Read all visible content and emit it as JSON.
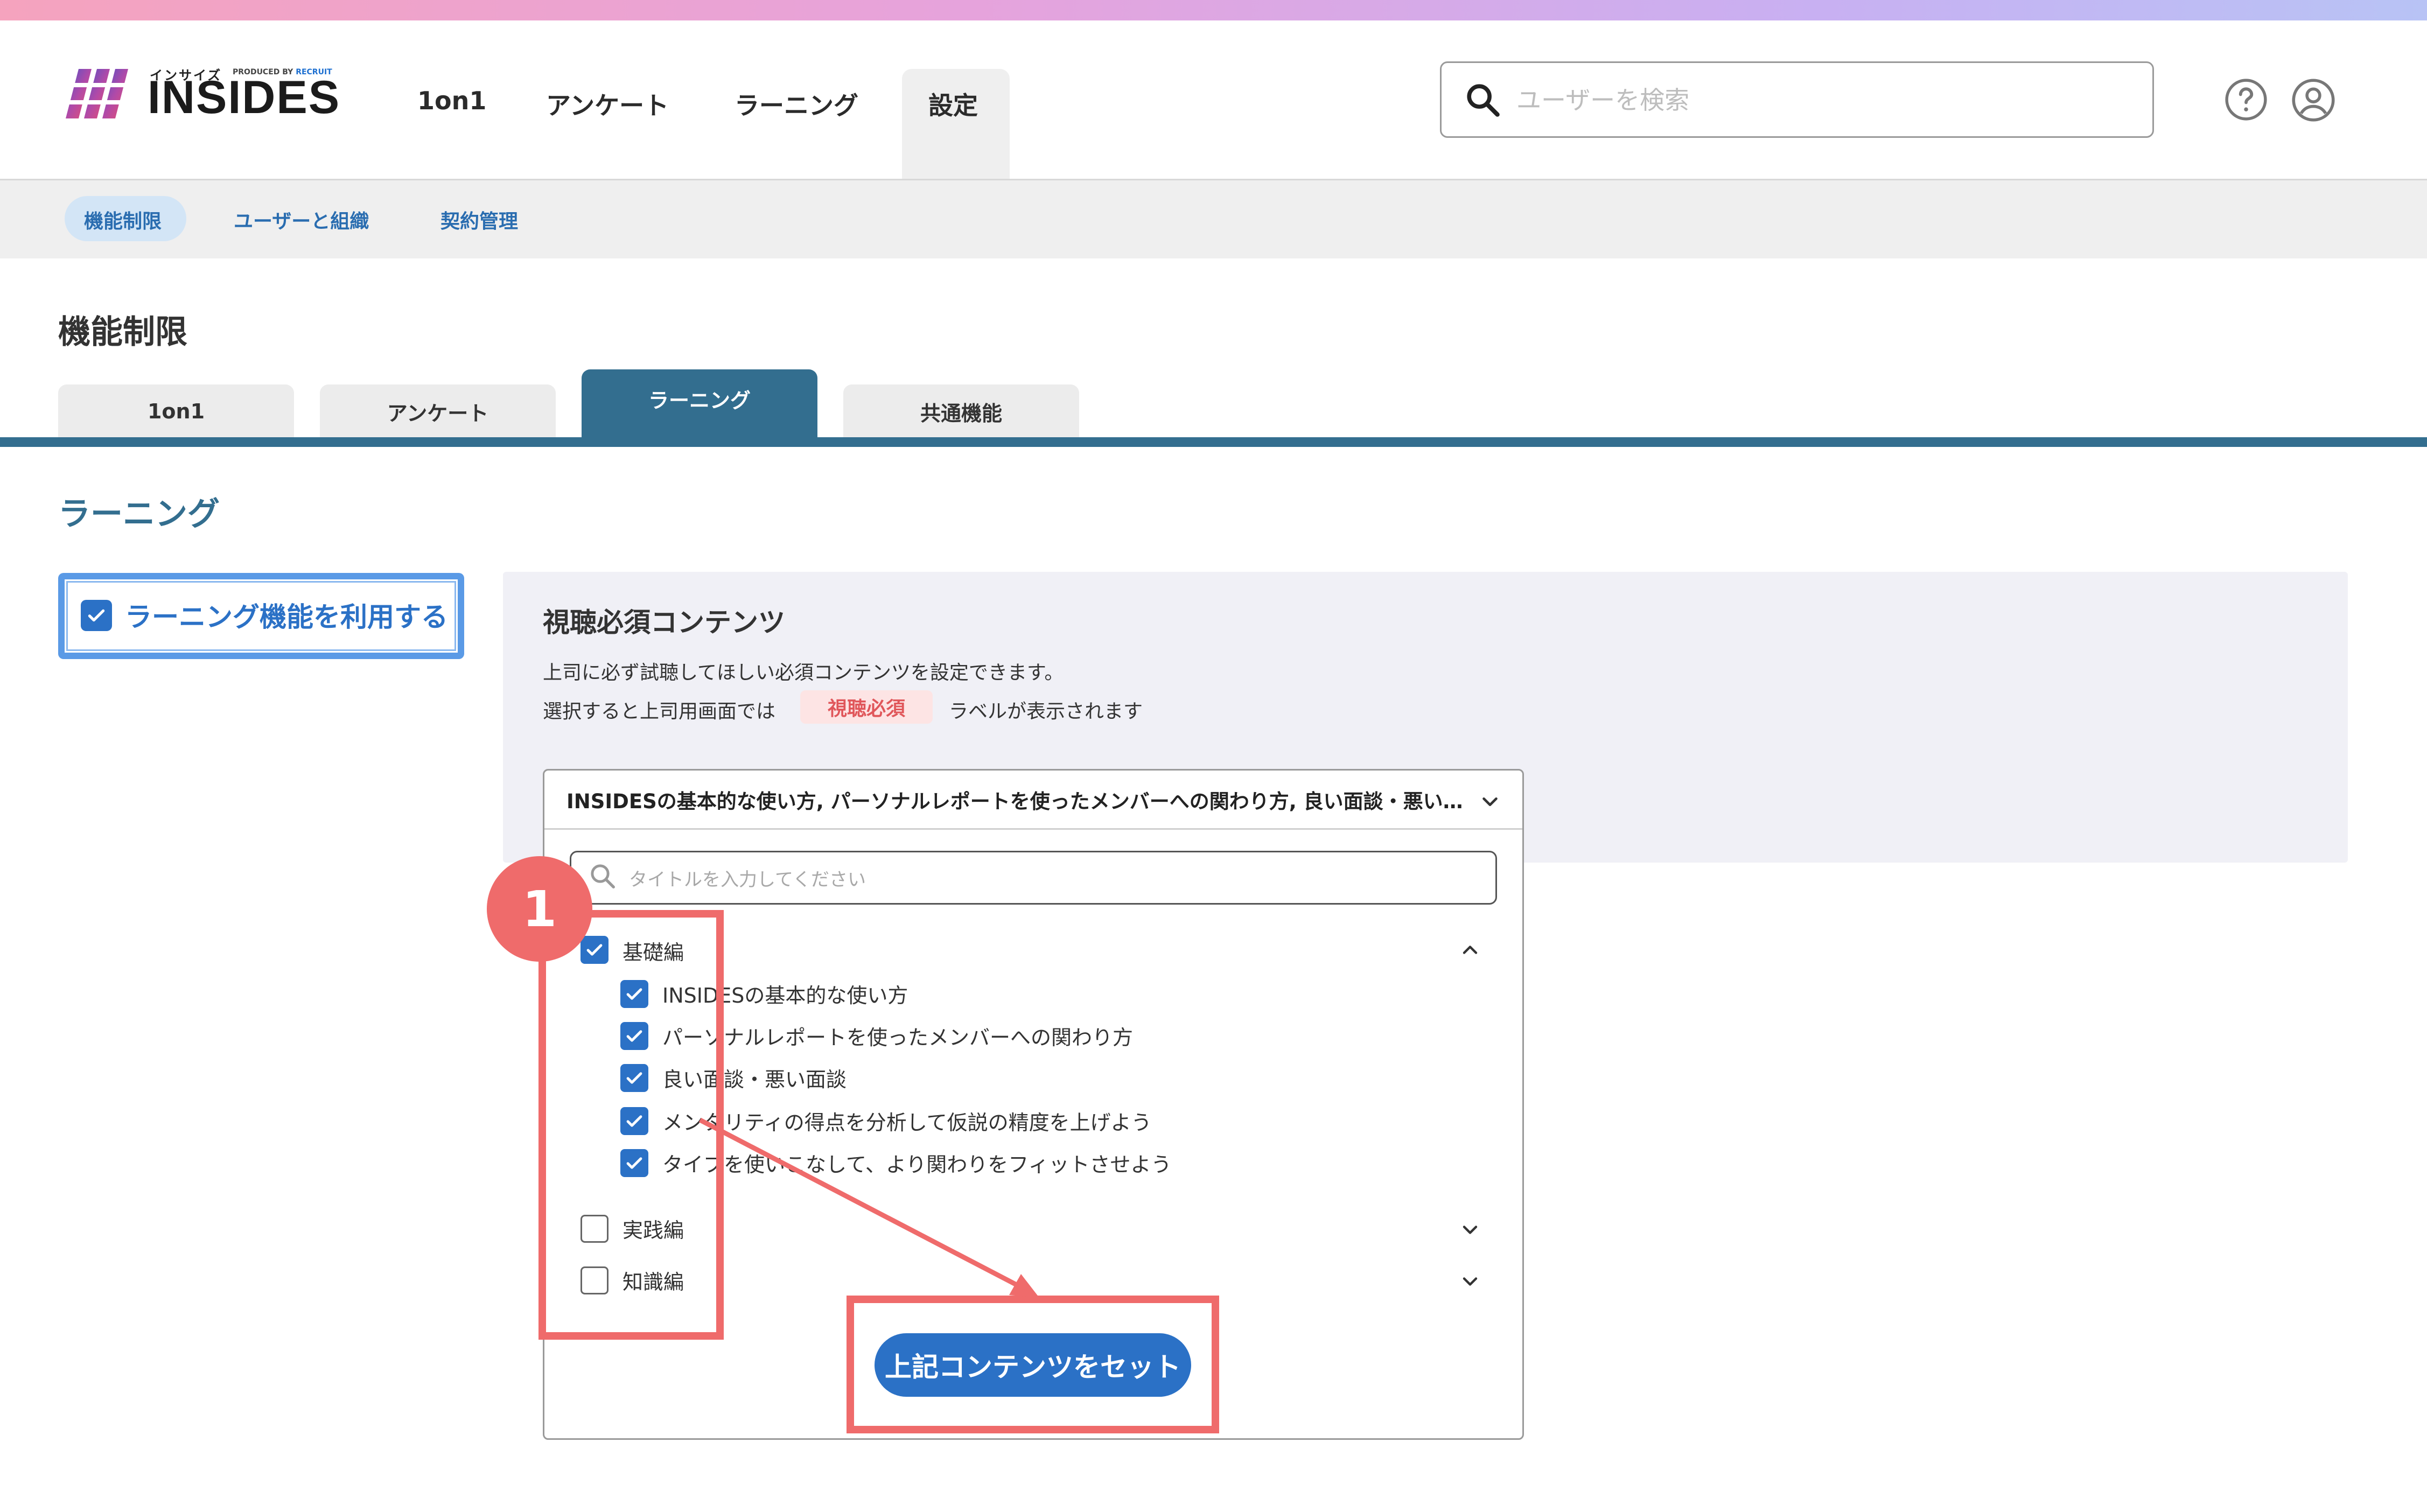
{
  "logo": {
    "kana": "インサイズ",
    "produced_by": "PRODUCED BY",
    "brand": "RECRUIT",
    "name": "INSIDES"
  },
  "nav": {
    "items": [
      "1on1",
      "アンケート",
      "ラーニング",
      "設定"
    ],
    "active": "設定"
  },
  "search": {
    "placeholder": "ユーザーを検索",
    "icon": "search-icon"
  },
  "header_icons": [
    "help-icon",
    "user-account-icon"
  ],
  "subnav": {
    "items": [
      "機能制限",
      "ユーザーと組織",
      "契約管理"
    ],
    "active": "機能制限"
  },
  "page_title": "機能制限",
  "tabs": {
    "items": [
      "1on1",
      "アンケート",
      "ラーニング",
      "共通機能"
    ],
    "active": "ラーニング"
  },
  "section_title": "ラーニング",
  "enable": {
    "label": "ラーニング機能を利用する",
    "checked": true
  },
  "panel": {
    "title": "視聴必須コンテンツ",
    "desc1": "上司に必ず試聴してほしい必須コンテンツを設定できます。",
    "desc2_before": "選択すると上司用画面では",
    "badge": "視聴必須",
    "desc2_after": "ラベルが表示されます"
  },
  "dropdown": {
    "selected": "INSIDESの基本的な使い方, パーソナルレポートを使ったメンバーへの関わり方, 良い面談・悪い…",
    "filter_placeholder": "タイトルを入力してください",
    "groups": [
      {
        "label": "基礎編",
        "checked": true,
        "expanded": true,
        "items": [
          {
            "label": "INSIDESの基本的な使い方",
            "checked": true
          },
          {
            "label": "パーソナルレポートを使ったメンバーへの関わり方",
            "checked": true
          },
          {
            "label": "良い面談・悪い面談",
            "checked": true
          },
          {
            "label": "メンタリティの得点を分析して仮説の精度を上げよう",
            "checked": true
          },
          {
            "label": "タイプを使いこなして、より関わりをフィットさせよう",
            "checked": true
          }
        ]
      },
      {
        "label": "実践編",
        "checked": false,
        "expanded": false
      },
      {
        "label": "知識編",
        "checked": false,
        "expanded": false
      }
    ],
    "set_button": "上記コンテンツをセット"
  },
  "annotation": {
    "step": "1",
    "color": "#ef6b6b"
  },
  "colors": {
    "primary": "#2b71c6",
    "tab_active": "#336e8f",
    "badge_text": "#e0565a"
  }
}
